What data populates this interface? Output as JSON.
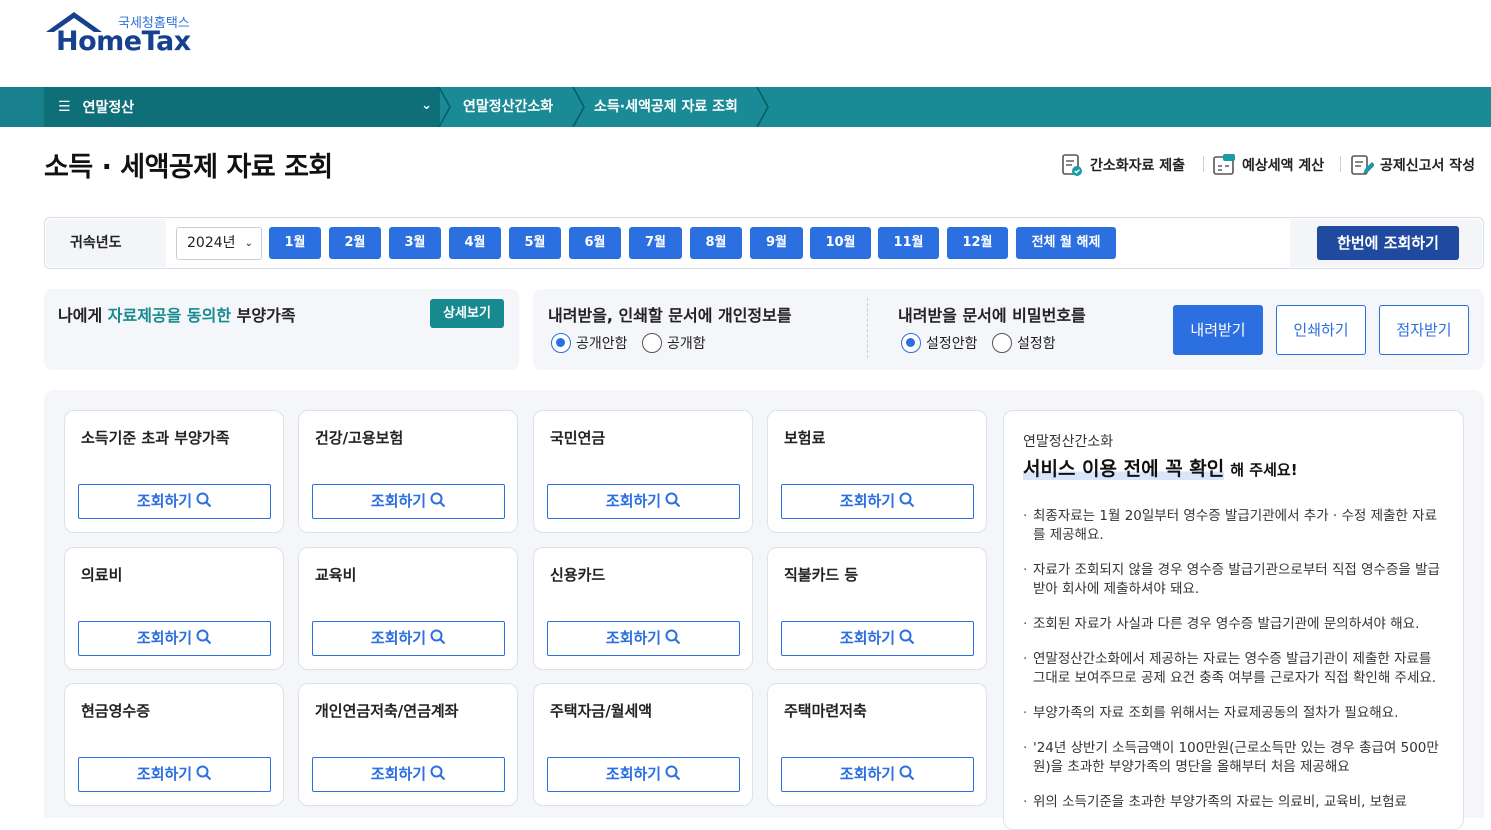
{
  "logo": {
    "kr": "국세청홈택스",
    "en": "HomeTax"
  },
  "nav": {
    "menu_label": "연말정산",
    "crumbs": [
      "연말정산간소화",
      "소득·세액공제 자료 조회"
    ]
  },
  "title": "소득 · 세액공제 자료 조회",
  "top_actions": [
    "간소화자료 제출",
    "예상세액 계산",
    "공제신고서 작성"
  ],
  "year": {
    "label": "귀속년도",
    "selected": "2024년",
    "months": [
      "1월",
      "2월",
      "3월",
      "4월",
      "5월",
      "6월",
      "7월",
      "8월",
      "9월",
      "10월",
      "11월",
      "12월"
    ],
    "clear_all": "전체 월 해제",
    "query_once": "한번에 조회하기"
  },
  "dependents": {
    "text_pre": "나에게",
    "text_highlight": "자료제공을 동의한",
    "text_post": "부양가족",
    "detail_button": "상세보기"
  },
  "privacy": {
    "title": "내려받을, 인쇄할 문서에 개인정보를",
    "options": [
      "공개안함",
      "공개함"
    ],
    "selected": "공개안함"
  },
  "password": {
    "title": "내려받을 문서에 비밀번호를",
    "options": [
      "설정안함",
      "설정함"
    ],
    "selected": "설정안함"
  },
  "actions": {
    "download": "내려받기",
    "print": "인쇄하기",
    "braille": "점자받기"
  },
  "cards": [
    {
      "title": "소득기준 초과 부양가족",
      "button": "조회하기"
    },
    {
      "title": "건강/고용보험",
      "button": "조회하기"
    },
    {
      "title": "국민연금",
      "button": "조회하기"
    },
    {
      "title": "보험료",
      "button": "조회하기"
    },
    {
      "title": "의료비",
      "button": "조회하기"
    },
    {
      "title": "교육비",
      "button": "조회하기"
    },
    {
      "title": "신용카드",
      "button": "조회하기"
    },
    {
      "title": "직불카드 등",
      "button": "조회하기"
    },
    {
      "title": "현금영수증",
      "button": "조회하기"
    },
    {
      "title": "개인연금저축/연금계좌",
      "button": "조회하기"
    },
    {
      "title": "주택자금/월세액",
      "button": "조회하기"
    },
    {
      "title": "주택마련저축",
      "button": "조회하기"
    }
  ],
  "notice": {
    "sub": "연말정산간소화",
    "headline": "서비스 이용 전에 꼭 확인",
    "headline_tail": "해 주세요!",
    "items": [
      "최종자료는 1월 20일부터 영수증 발급기관에서 추가 · 수정 제출한 자료를 제공해요.",
      "자료가 조회되지 않을 경우 영수증 발급기관으로부터 직접 영수증을 발급받아 회사에 제출하셔야 돼요.",
      "조회된 자료가 사실과 다른 경우 영수증 발급기관에 문의하셔야 해요.",
      "연말정산간소화에서 제공하는 자료는 영수증 발급기관이 제출한 자료를 그대로 보여주므로 공제 요건 충족 여부를 근로자가 직접 확인해 주세요.",
      "부양가족의 자료 조회를 위해서는 자료제공동의 절차가 필요해요.",
      "'24년 상반기 소득금액이 100만원(근로소득만 있는 경우 총급여 500만원)을 초과한 부양가족의 명단을 올해부터 처음 제공해요",
      "위의 소득기준을 초과한 부양가족의 자료는 의료비, 교육비, 보험료"
    ]
  },
  "colors": {
    "teal": "#1a8a96",
    "blue": "#2b6fe0",
    "navy": "#1f4aa0"
  }
}
